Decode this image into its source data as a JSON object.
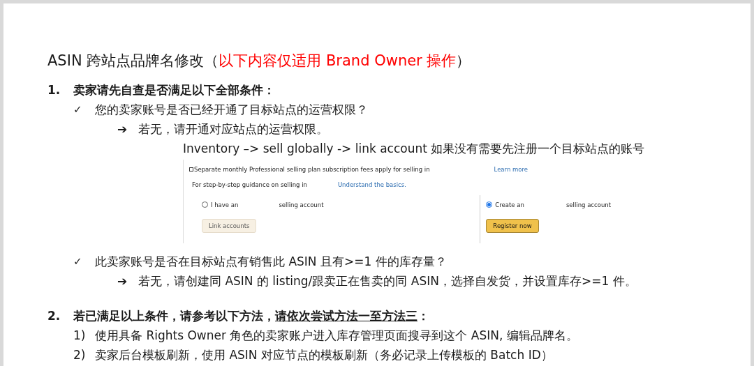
{
  "title": {
    "text": "ASIN 跨站点品牌名修改（",
    "note": "以下内容仅适用 Brand Owner 操作",
    "end": "）"
  },
  "sections": [
    {
      "number": "1.",
      "heading": "卖家请先自查是否满足以下全部条件：",
      "items": [
        {
          "kind": "check",
          "marker": "✓",
          "text": "您的卖家账号是否已经开通了目标站点的运营权限？",
          "children": [
            {
              "kind": "arrow",
              "marker": "➔",
              "text": "若无，请开通对应站点的运营权限。"
            },
            {
              "kind": "note",
              "text": "Inventory –> sell globally -> link account 如果没有需要先注册一个目标站点的账号"
            },
            {
              "kind": "screenshot",
              "fee_note": "Separate monthly Professional selling plan subscription fees apply for selling in",
              "learn_more": "Learn more",
              "guidance": "For step-by-step guidance on selling in",
              "basics": "Understand the basics.",
              "options": [
                {
                  "start": "I have an",
                  "end": "selling account",
                  "selected": false,
                  "button": "Link accounts",
                  "kind": "secondary"
                },
                {
                  "start": "Create an",
                  "end": "selling account",
                  "selected": true,
                  "button": "Register now",
                  "kind": "primary"
                }
              ]
            }
          ]
        },
        {
          "kind": "check",
          "marker": "✓",
          "text": "此卖家账号是否在目标站点有销售此 ASIN 且有>=1 件的库存量？",
          "children": [
            {
              "kind": "arrow",
              "marker": "➔",
              "text": "若无，请创建同 ASIN 的 listing/跟卖正在售卖的同 ASIN，选择自发货，并设置库存>=1 件。"
            }
          ]
        }
      ]
    },
    {
      "number": "2.",
      "heading": "若已满足以上条件，请参考以下方法，",
      "heading_underlined": "请依次尝试方法一至方法三",
      "heading_end": "：",
      "items": [
        {
          "kind": "numbered",
          "marker": "1)",
          "text": "使用具备 Rights Owner 角色的卖家账户进入库存管理页面搜寻到这个 ASIN, 编辑品牌名。"
        },
        {
          "kind": "numbered",
          "marker": "2)",
          "text": "卖家后台模板刷新，使用 ASIN 对应节点的模板刷新（务必记录上传模板的 Batch ID）"
        }
      ]
    }
  ]
}
